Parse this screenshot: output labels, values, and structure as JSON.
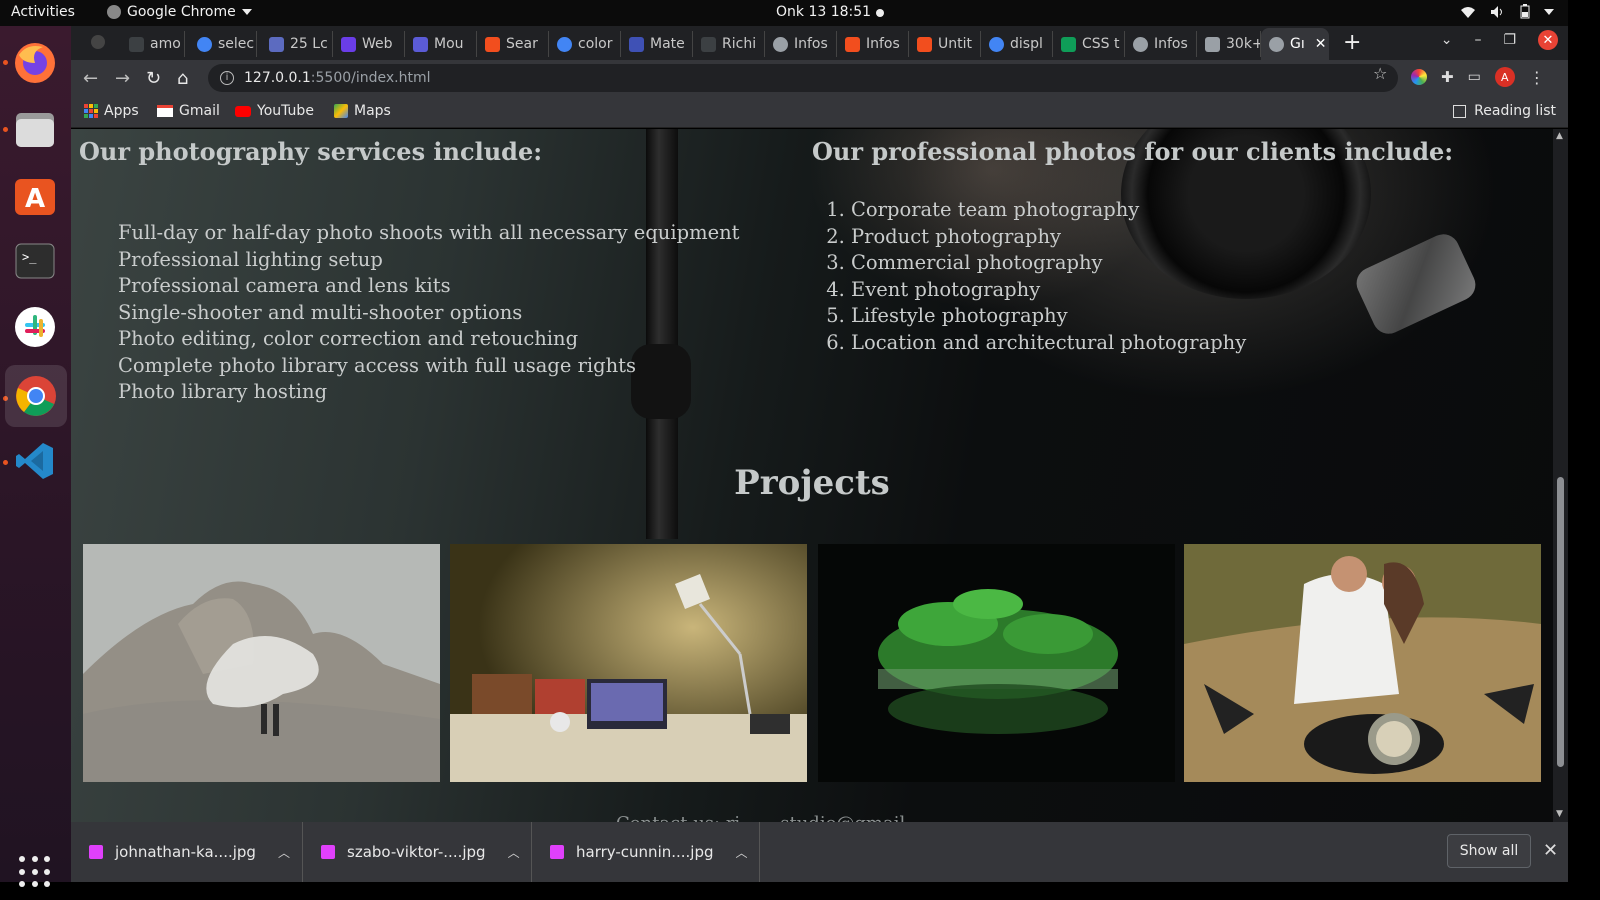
{
  "system": {
    "activities": "Activities",
    "app_name": "Google Chrome",
    "clock": "Onk 13  18:51"
  },
  "tabs": [
    {
      "label": "amo",
      "color": "#3c4043"
    },
    {
      "label": "selec",
      "color": "#4285f4"
    },
    {
      "label": "25 Lc",
      "color": "#5c6bc0"
    },
    {
      "label": "Web",
      "color": "#6a3de8"
    },
    {
      "label": "Mou",
      "color": "#5b5bd6"
    },
    {
      "label": "Sear",
      "color": "#f24e1e"
    },
    {
      "label": "color",
      "color": "#4285f4"
    },
    {
      "label": "Mate",
      "color": "#3f51b5"
    },
    {
      "label": "Richi",
      "color": "#3c4043"
    },
    {
      "label": "Infos",
      "color": "#9aa0a6"
    },
    {
      "label": "Infos",
      "color": "#f24e1e"
    },
    {
      "label": "Untit",
      "color": "#f24e1e"
    },
    {
      "label": "displ",
      "color": "#4285f4"
    },
    {
      "label": "CSS t",
      "color": "#0f9d58"
    },
    {
      "label": "Infos",
      "color": "#9aa0a6"
    },
    {
      "label": "30k+",
      "color": "#9aa0a6"
    },
    {
      "label": "Gı",
      "color": "#9aa0a6",
      "active": true
    }
  ],
  "address": {
    "host": "127.0.0.1",
    "path": ":5500/index.html"
  },
  "bookmarks": {
    "apps": "Apps",
    "gmail": "Gmail",
    "youtube": "YouTube",
    "maps": "Maps",
    "reading_list": "Reading list"
  },
  "page": {
    "services_title": "Our photography services include:",
    "services": [
      "Full-day or half-day photo shoots with all necessary equipment",
      "Professional lighting setup",
      "Professional camera and lens kits",
      "Single-shooter and multi-shooter options",
      "Photo editing, color correction and retouching",
      "Complete photo library access with full usage rights",
      "Photo library hosting"
    ],
    "clients_title": "Our professional photos for our clients include:",
    "clients": [
      "Corporate team photography",
      "Product photography",
      "Commercial photography",
      "Event photography",
      "Lifestyle photography",
      "Location and architectural photography"
    ],
    "projects_title": "Projects",
    "contact_partial": "Contact us: ri...  ...studio@gmail..."
  },
  "downloads": {
    "files": [
      "johnathan-ka....jpg",
      "szabo-viktor-....jpg",
      "harry-cunnin....jpg"
    ],
    "show_all": "Show all"
  }
}
